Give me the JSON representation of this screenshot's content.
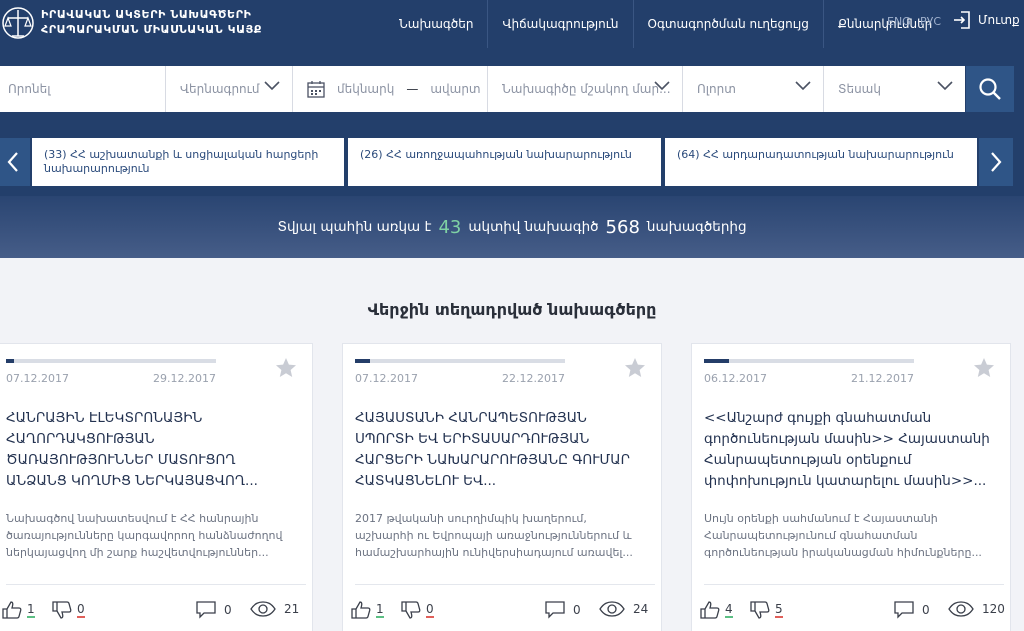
{
  "header": {
    "logo_line1": "ԻՐԱՎԱԿԱՆ ԱԿՏԵՐԻ ՆԱԽԱԳԾԵՐԻ",
    "logo_line2": "ՀՐԱՊԱՐԱԿՄԱՆ ՄԻԱՍՆԱԿԱՆ ԿԱՅՔ",
    "nav": [
      "Նախագծեր",
      "Վիճակագրություն",
      "Օգտագործման ուղեցույց",
      "Քննարկումներ"
    ],
    "lang_en": "ENG",
    "lang_ru": "РУС",
    "login": "Մուտք"
  },
  "search": {
    "query_placeholder": "Որոնել",
    "title_select": "Վերնագրում",
    "date_from": "մեկնարկ",
    "date_sep": "—",
    "date_to": "ավարտ",
    "initiator_select": "Նախագիծը մշակող մար...",
    "field_select": "Ոլորտ",
    "type_select": "Տեսակ"
  },
  "ministries": [
    {
      "label": "(33) ՀՀ աշխատանքի և սոցիալական հարցերի նախարարություն"
    },
    {
      "label": "(26) ՀՀ առողջապահության նախարարություն"
    },
    {
      "label": "(64) ՀՀ արդարադատության նախարարություն"
    }
  ],
  "stats": {
    "prefix": "Տվյալ պահին առկա է",
    "active": "43",
    "middle": "ակտիվ նախագիծ",
    "total": "568",
    "suffix": "նախագծերից"
  },
  "latest": {
    "title": "Վերջին տեղադրված նախագծերը",
    "cards": [
      {
        "start": "07.12.2017",
        "end": "29.12.2017",
        "progress": 0.04,
        "title": "ՀԱՆՐԱՅԻՆ ԷԼԵԿՏՐՈՆԱՅԻՆ ՀԱՂՈՐԴԱԿՑՈՒԹՅԱՆ ԾԱՌԱՅՈՒԹՅՈՒՆՆԵՐ ՄԱՏՈՒՑՈՂ ԱՆՁԱՆՑ ԿՈՂՄԻՑ ՆԵՐԿԱՅԱՑՎՈՂ...",
        "desc": "Նախագծով նախատեսվում է ՀՀ հանրային ծառայությունները կարգավորող հանձնաժողով ներկայացվող մի շարք հաշվետվություններ...",
        "likes": "1",
        "dislikes": "0",
        "comments": "0",
        "views": "21"
      },
      {
        "start": "07.12.2017",
        "end": "22.12.2017",
        "progress": 0.07,
        "title": "ՀԱՅԱՍՏԱՆԻ ՀԱՆՐԱՊԵՏՈՒԹՅԱՆ ՍՊՈՐՏԻ ԵՎ ԵՐԻՏԱՍԱՐԴՈՒԹՅԱՆ ՀԱՐՑԵՐԻ ՆԱԽԱՐԱՐՈՒԹՅԱՆԸ ԳՈՒՄԱՐ ՀԱՏԿԱՑՆԵԼՈՒ ԵՎ...",
        "desc": "2017 թվականի սուրղիմպիկ խաղերում, աշխարհի ու Եվրոպայի առաջնություններում և համաշխարհային ունիվերսիադայում առավել...",
        "likes": "1",
        "dislikes": "0",
        "comments": "0",
        "views": "24"
      },
      {
        "start": "06.12.2017",
        "end": "21.12.2017",
        "progress": 0.12,
        "title": "<<Անշարժ գույքի գնահատման գործունեության մասին>> Հայաստանի Հանրապետության օրենքում փոփոխություն կատարելու մասին>>...",
        "desc": "Սույն օրենքի սահմանում է Հայաստանի Հանրապետությունում գնահատման գործունեության իրականացման հիմունքները...",
        "likes": "4",
        "dislikes": "5",
        "comments": "0",
        "views": "120"
      }
    ]
  },
  "colors": {
    "header_bg": "#233f6b",
    "accent_green": "#7fd1a4",
    "search_button": "#2f5587"
  },
  "icons": [
    "coat-of-arms-icon",
    "login-icon",
    "calendar-icon",
    "chevron-down-icon",
    "search-icon",
    "chevron-left-icon",
    "chevron-right-icon",
    "star-icon",
    "thumb-up-icon",
    "thumb-down-icon",
    "comment-icon",
    "eye-icon"
  ]
}
